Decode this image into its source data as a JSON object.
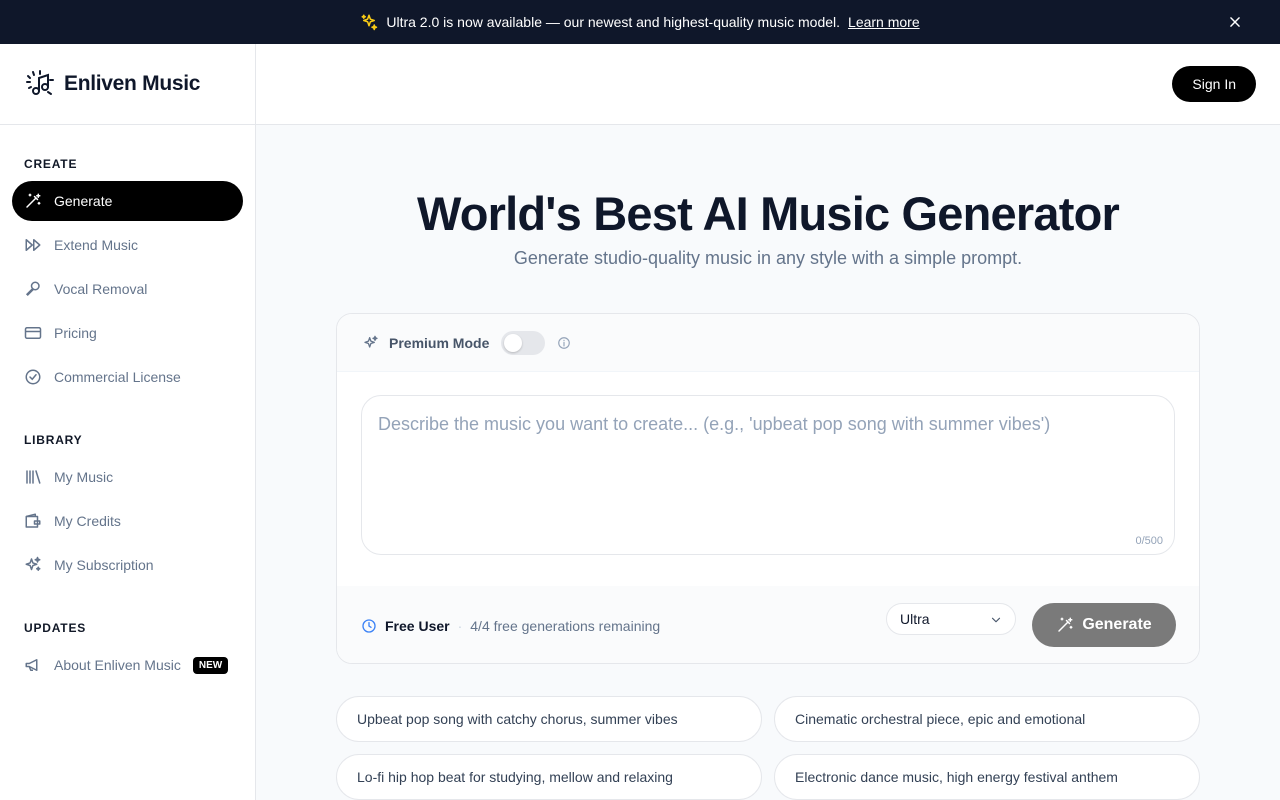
{
  "banner": {
    "icon": "sparkle-icon",
    "text": "Ultra 2.0 is now available — our newest and highest-quality music model.",
    "link": "Learn more"
  },
  "brand": {
    "name": "Enliven Music",
    "logo": "music-note-logo"
  },
  "sidebar": {
    "create_title": "CREATE",
    "create_items": [
      {
        "label": "Generate",
        "icon": "magic-wand-icon",
        "active": true
      },
      {
        "label": "Extend Music",
        "icon": "fast-forward-icon"
      },
      {
        "label": "Vocal Removal",
        "icon": "microphone-icon"
      },
      {
        "label": "Pricing",
        "icon": "credit-card-icon"
      },
      {
        "label": "Commercial License",
        "icon": "check-badge-icon"
      }
    ],
    "library_title": "LIBRARY",
    "library_items": [
      {
        "label": "My Music",
        "icon": "library-icon"
      },
      {
        "label": "My Credits",
        "icon": "wallet-icon"
      },
      {
        "label": "My Subscription",
        "icon": "sparkles-icon"
      }
    ],
    "updates_title": "UPDATES",
    "updates_items": [
      {
        "label": "About Enliven Music",
        "icon": "megaphone-icon",
        "badge": "NEW"
      }
    ]
  },
  "header": {
    "sign_in": "Sign In"
  },
  "hero": {
    "title": "World's Best AI Music Generator",
    "subtitle": "Generate studio-quality music in any style with a simple prompt."
  },
  "generator": {
    "premium_label": "Premium Mode",
    "premium_enabled": false,
    "prompt_value": "",
    "prompt_placeholder": "Describe the music you want to create... (e.g., 'upbeat pop song with summer vibes')",
    "counter": "0/500",
    "user_tier": "Free User",
    "separator": "·",
    "remaining": "4/4 free generations remaining",
    "model": "Ultra",
    "generate_label": "Generate"
  },
  "suggestions": [
    "Upbeat pop song with catchy chorus, summer vibes",
    "Cinematic orchestral piece, epic and emotional",
    "Lo-fi hip hop beat for studying, mellow and relaxing",
    "Electronic dance music, high energy festival anthem"
  ],
  "colors": {
    "banner_bg": "#0f172a",
    "accent": "#000000",
    "generate_button": "#7a7a7a",
    "clock": "#3b82f6"
  }
}
